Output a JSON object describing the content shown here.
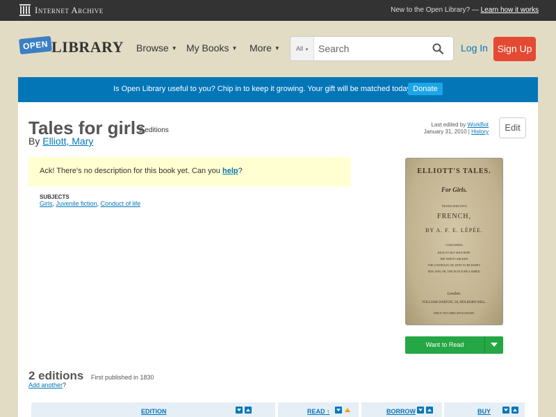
{
  "ia_bar": {
    "name": "Internet Archive",
    "new_text": "New to the Open Library? —",
    "learn_link": "Learn how it works"
  },
  "header": {
    "logo_open": "OPEN",
    "logo_library": "LIBRARY",
    "nav": [
      {
        "label": "Browse"
      },
      {
        "label": "My Books"
      },
      {
        "label": "More"
      }
    ],
    "search_scope": "All",
    "search_placeholder": "Search",
    "login": "Log In",
    "signup": "Sign Up"
  },
  "banner": {
    "text": "Is Open Library useful to you? Chip in to keep it growing. Your gift will be matched today!",
    "donate": "Donate"
  },
  "book": {
    "title": "Tales for girls",
    "editions_count": "2 editions",
    "by": "By",
    "author": "Elliott, Mary",
    "last_edited_prefix": "Last edited by",
    "last_edited_user": "WorkBot",
    "last_edited_date": "January 31, 2010",
    "history": "History",
    "edit": "Edit",
    "desc_prefix": "Ack! There's no description for this book yet. Can you",
    "desc_link": "help",
    "desc_suffix": "?",
    "subjects_heading": "SUBJECTS",
    "subjects": [
      "Girls",
      "Juvenile fiction",
      "Conduct of life"
    ]
  },
  "cover": {
    "lines": [
      "ELLIOTT'S TALES.",
      "For Girls.",
      "TRANSLATED INTO",
      "FRENCH,",
      "BY A. F. E. LÉPÉE.",
      "CONTAINING",
      "BEAUTY BUT SKIN DEEP.",
      "THE WHITE CHICKEN.",
      "THE CONTRAST; OR, HOW TO BE HAPPY.",
      "IDLE ANN; OR, THE DUNCE RECLAIMED.",
      "London.",
      "WILLIAM DARTON, 58, HOLBORN HILL.",
      "PRICE TWO SHILLINGS SEWED."
    ]
  },
  "want_to_read": "Want to Read",
  "editions_section": {
    "heading": "2 editions",
    "first_published": "First published in 1830",
    "add_another": "Add another",
    "add_suffix": "?",
    "columns": [
      {
        "label": "EDITION"
      },
      {
        "label": "READ ↑"
      },
      {
        "label": "BORROW"
      },
      {
        "label": "BUY"
      }
    ]
  }
}
